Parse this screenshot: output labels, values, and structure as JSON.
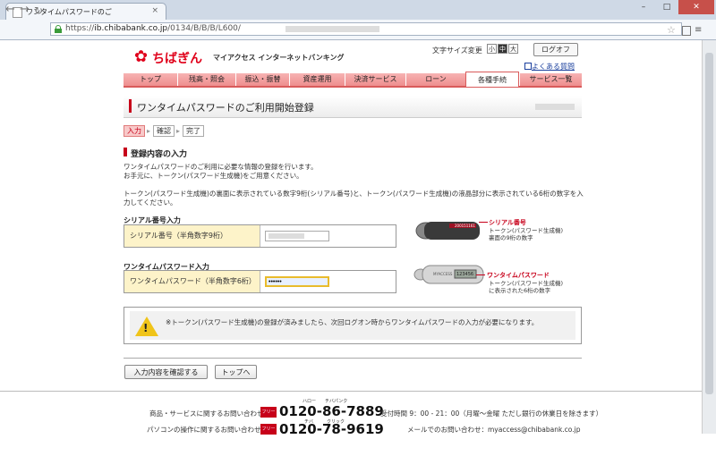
{
  "browser": {
    "tab_title": "ワンタイムパスワードのご",
    "tab_close": "×",
    "url_prefix": "https://",
    "url_host": "ib.chibabank.co.jp",
    "url_path": "/0134/B/B/B/L600/",
    "win_minimize": "–",
    "win_maximize": "□",
    "win_close": "✕"
  },
  "header": {
    "logo_mark": "✿",
    "logo_text": "ちばぎん",
    "logo_subtitle": "マイアクセス インターネットバンキング",
    "font_size_label": "文字サイズ変更",
    "font_sizes": [
      "小",
      "中",
      "大"
    ],
    "logout": "ログオフ",
    "faq": "よくある質問"
  },
  "global_nav": [
    {
      "label": "トップ"
    },
    {
      "label": "残高・照会"
    },
    {
      "label": "振込・振替"
    },
    {
      "label": "資産運用"
    },
    {
      "label": "決済サービス"
    },
    {
      "label": "ローン"
    },
    {
      "label": "各種手続"
    },
    {
      "label": "サービス一覧"
    }
  ],
  "page": {
    "title": "ワンタイムパスワードのご利用開始登録",
    "steps": [
      "入力",
      "確認",
      "完了"
    ],
    "section_title": "登録内容の入力",
    "intro_1": "ワンタイムパスワードのご利用に必要な情報の登録を行います。",
    "intro_2": "お手元に、トークン(パスワード生成機)をご用意ください。",
    "instruction_1": "トークン(パスワード生成機)の裏面に表示されている数字9桁(シリアル番号)と、トークン(パスワード生成機)の液晶部分に表示されている6桁の数字を入",
    "instruction_2": "力してください。"
  },
  "serial": {
    "section_label": "シリアル番号入力",
    "field_label": "シリアル番号（半角数字9桁）",
    "value": ""
  },
  "otp": {
    "section_label": "ワンタイムパスワード入力",
    "field_label": "ワンタイムパスワード（半角数字6桁）",
    "value": "••••••"
  },
  "token_serial": {
    "label": "シリアル番号",
    "desc_1": "トークン(パスワード生成機)",
    "desc_2": "裏面の9桁の数字",
    "device_text": "200151161"
  },
  "token_otp": {
    "label": "ワンタイムパスワード",
    "desc_1": "トークン(パスワード生成機)",
    "desc_2": "に表示された6桁の数字",
    "device_brand": "MYACCESS",
    "device_text": "123456"
  },
  "notice": {
    "mark": "!",
    "text": "※トークン(パスワード生成機)の登録が済みましたら、次回ログオン時からワンタイムパスワードの入力が必要になります。"
  },
  "buttons": {
    "confirm": "入力内容を確認する",
    "top": "トップへ"
  },
  "footer": {
    "row1_label": "商品・サービスに関するお問い合わせ：",
    "row1_freedial": "フリーダイヤル",
    "row1_phone": "0120-86-7889",
    "row1_ruby": "ハロー　　チバパンク",
    "row1_hours": "受付時間 9：00 - 21：00（月曜～金曜 ただし銀行の休業日を除きます）",
    "row2_label": "パソコンの操作に関するお問い合わせ：",
    "row2_freedial": "フリーダイヤル",
    "row2_phone": "0120-78-9619",
    "row2_ruby": "チバ　　　クリック",
    "row2_mail": "メールでのお問い合わせ：myaccess@chibabank.co.jp"
  },
  "colors": {
    "brand_red": "#e0001a",
    "nav_pink": "#f2a0a0",
    "warning_yellow": "#f0c419"
  }
}
